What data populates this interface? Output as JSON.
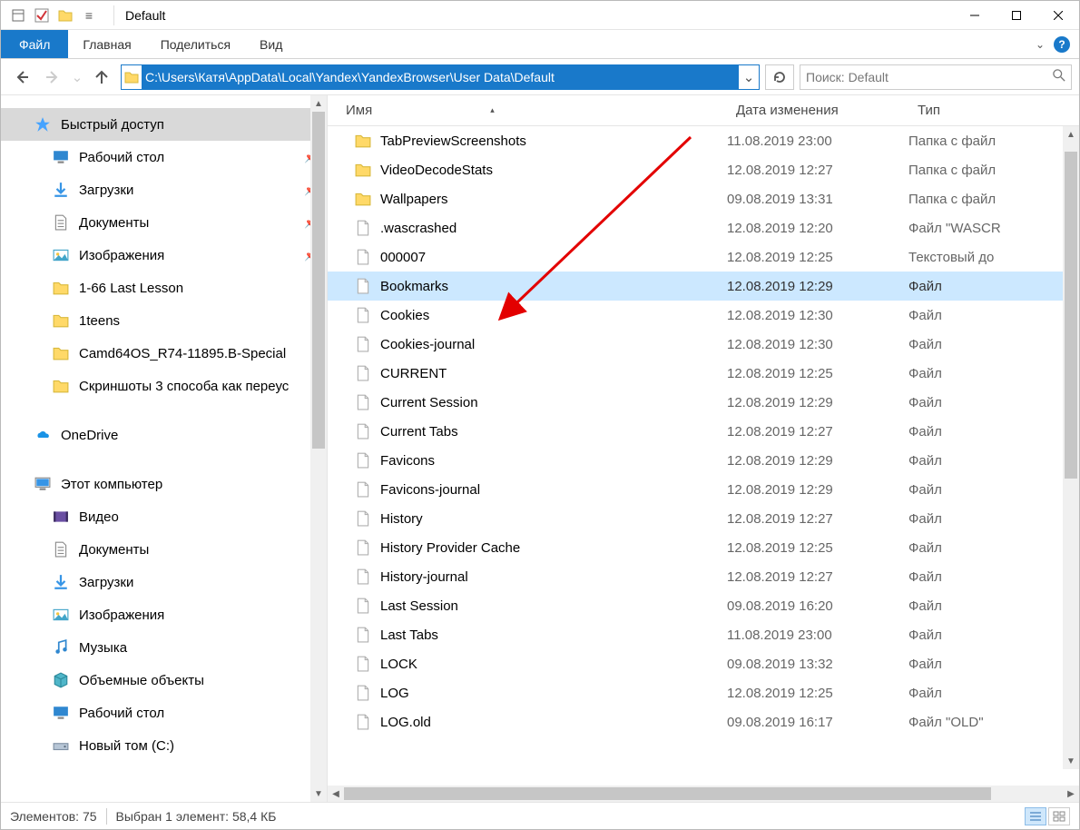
{
  "window": {
    "title": "Default"
  },
  "ribbon": {
    "file": "Файл",
    "home": "Главная",
    "share": "Поделиться",
    "view": "Вид"
  },
  "nav": {
    "path": "C:\\Users\\Катя\\AppData\\Local\\Yandex\\YandexBrowser\\User Data\\Default"
  },
  "search": {
    "placeholder": "Поиск: Default"
  },
  "sidebar": {
    "quick": {
      "label": "Быстрый доступ"
    },
    "items": [
      {
        "label": "Рабочий стол",
        "icon": "desktop",
        "pinned": true
      },
      {
        "label": "Загрузки",
        "icon": "down",
        "pinned": true
      },
      {
        "label": "Документы",
        "icon": "doc",
        "pinned": true
      },
      {
        "label": "Изображения",
        "icon": "pic",
        "pinned": true
      },
      {
        "label": "1-66 Last Lesson",
        "icon": "folder"
      },
      {
        "label": "1teens",
        "icon": "folder"
      },
      {
        "label": "Camd64OS_R74-11895.B-Special",
        "icon": "folder"
      },
      {
        "label": "Скриншоты 3 способа как переус",
        "icon": "folder"
      }
    ],
    "onedrive": {
      "label": "OneDrive"
    },
    "thispc": {
      "label": "Этот компьютер"
    },
    "pcitems": [
      {
        "label": "Видео",
        "icon": "video"
      },
      {
        "label": "Документы",
        "icon": "doc"
      },
      {
        "label": "Загрузки",
        "icon": "down"
      },
      {
        "label": "Изображения",
        "icon": "pic"
      },
      {
        "label": "Музыка",
        "icon": "music"
      },
      {
        "label": "Объемные объекты",
        "icon": "obj"
      },
      {
        "label": "Рабочий стол",
        "icon": "desktop"
      },
      {
        "label": "Новый том (C:)",
        "icon": "drive"
      }
    ]
  },
  "columns": {
    "name": "Имя",
    "date": "Дата изменения",
    "type": "Тип"
  },
  "files": [
    {
      "name": "TabPreviewScreenshots",
      "date": "11.08.2019 23:00",
      "type": "Папка с файл",
      "icon": "folder"
    },
    {
      "name": "VideoDecodeStats",
      "date": "12.08.2019 12:27",
      "type": "Папка с файл",
      "icon": "folder"
    },
    {
      "name": "Wallpapers",
      "date": "09.08.2019 13:31",
      "type": "Папка с файл",
      "icon": "folder"
    },
    {
      "name": ".wascrashed",
      "date": "12.08.2019 12:20",
      "type": "Файл \"WASCR",
      "icon": "file"
    },
    {
      "name": "000007",
      "date": "12.08.2019 12:25",
      "type": "Текстовый до",
      "icon": "text"
    },
    {
      "name": "Bookmarks",
      "date": "12.08.2019 12:29",
      "type": "Файл",
      "icon": "file",
      "selected": true
    },
    {
      "name": "Cookies",
      "date": "12.08.2019 12:30",
      "type": "Файл",
      "icon": "file"
    },
    {
      "name": "Cookies-journal",
      "date": "12.08.2019 12:30",
      "type": "Файл",
      "icon": "file"
    },
    {
      "name": "CURRENT",
      "date": "12.08.2019 12:25",
      "type": "Файл",
      "icon": "file"
    },
    {
      "name": "Current Session",
      "date": "12.08.2019 12:29",
      "type": "Файл",
      "icon": "file"
    },
    {
      "name": "Current Tabs",
      "date": "12.08.2019 12:27",
      "type": "Файл",
      "icon": "file"
    },
    {
      "name": "Favicons",
      "date": "12.08.2019 12:29",
      "type": "Файл",
      "icon": "file"
    },
    {
      "name": "Favicons-journal",
      "date": "12.08.2019 12:29",
      "type": "Файл",
      "icon": "file"
    },
    {
      "name": "History",
      "date": "12.08.2019 12:27",
      "type": "Файл",
      "icon": "file"
    },
    {
      "name": "History Provider Cache",
      "date": "12.08.2019 12:25",
      "type": "Файл",
      "icon": "file"
    },
    {
      "name": "History-journal",
      "date": "12.08.2019 12:27",
      "type": "Файл",
      "icon": "file"
    },
    {
      "name": "Last Session",
      "date": "09.08.2019 16:20",
      "type": "Файл",
      "icon": "file"
    },
    {
      "name": "Last Tabs",
      "date": "11.08.2019 23:00",
      "type": "Файл",
      "icon": "file"
    },
    {
      "name": "LOCK",
      "date": "09.08.2019 13:32",
      "type": "Файл",
      "icon": "file"
    },
    {
      "name": "LOG",
      "date": "12.08.2019 12:25",
      "type": "Файл",
      "icon": "file"
    },
    {
      "name": "LOG.old",
      "date": "09.08.2019 16:17",
      "type": "Файл \"OLD\"",
      "icon": "file"
    }
  ],
  "status": {
    "count_label": "Элементов: 75",
    "selection_label": "Выбран 1 элемент: 58,4 КБ"
  }
}
